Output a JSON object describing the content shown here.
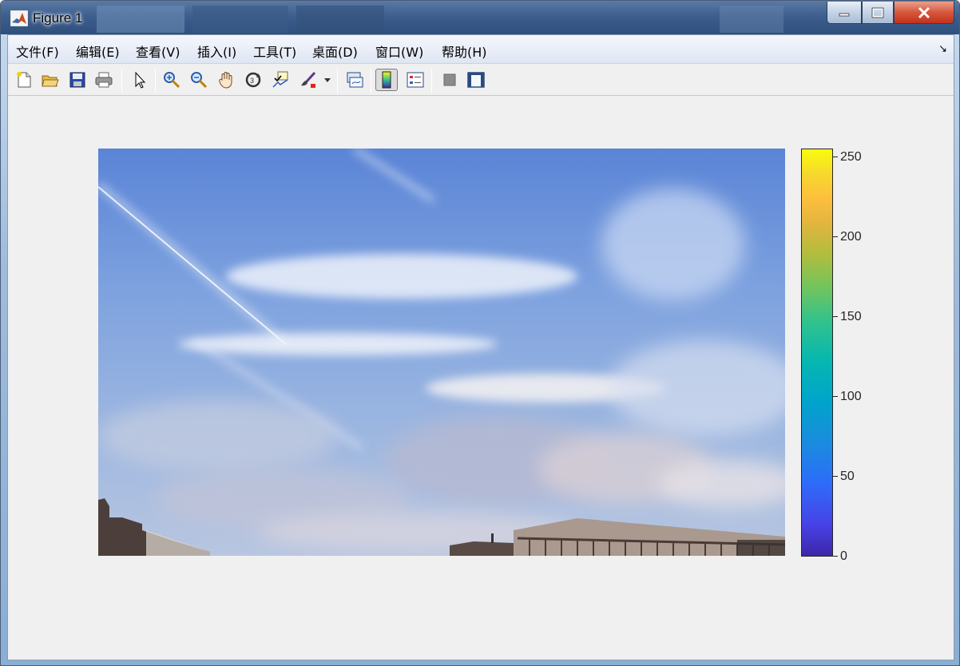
{
  "window": {
    "title": "Figure 1",
    "controls": {
      "minimize": "minimize-icon",
      "maximize": "maximize-icon",
      "close": "close-icon"
    }
  },
  "menubar": {
    "items": [
      {
        "label": "文件(F)"
      },
      {
        "label": "编辑(E)"
      },
      {
        "label": "查看(V)"
      },
      {
        "label": "插入(I)"
      },
      {
        "label": "工具(T)"
      },
      {
        "label": "桌面(D)"
      },
      {
        "label": "窗口(W)"
      },
      {
        "label": "帮助(H)"
      }
    ],
    "dock_arrow": "↘"
  },
  "toolbar": {
    "buttons": [
      {
        "icon": "new-figure-icon"
      },
      {
        "icon": "open-file-icon"
      },
      {
        "icon": "save-icon"
      },
      {
        "icon": "print-icon"
      },
      {
        "icon": "select-arrow-icon"
      },
      {
        "icon": "zoom-in-icon"
      },
      {
        "icon": "zoom-out-icon"
      },
      {
        "icon": "pan-hand-icon"
      },
      {
        "icon": "rotate-3d-icon"
      },
      {
        "icon": "data-cursor-icon"
      },
      {
        "icon": "brush-icon"
      },
      {
        "icon": "link-plot-icon"
      },
      {
        "icon": "colorbar-icon",
        "pressed": true
      },
      {
        "icon": "legend-icon"
      },
      {
        "icon": "hide-plot-tools-icon"
      },
      {
        "icon": "show-plot-tools-icon"
      }
    ]
  },
  "figure": {
    "image": {
      "subject": "sky-with-clouds-and-buildings"
    },
    "colorbar": {
      "colormap": "parula",
      "range": [
        0,
        255
      ],
      "ticks": [
        "0",
        "50",
        "100",
        "150",
        "200",
        "250"
      ]
    }
  },
  "colors": {
    "client_bg": "#f0f0f0",
    "title_grad_top": "#5a7aa3",
    "close_red": "#c1321a"
  }
}
